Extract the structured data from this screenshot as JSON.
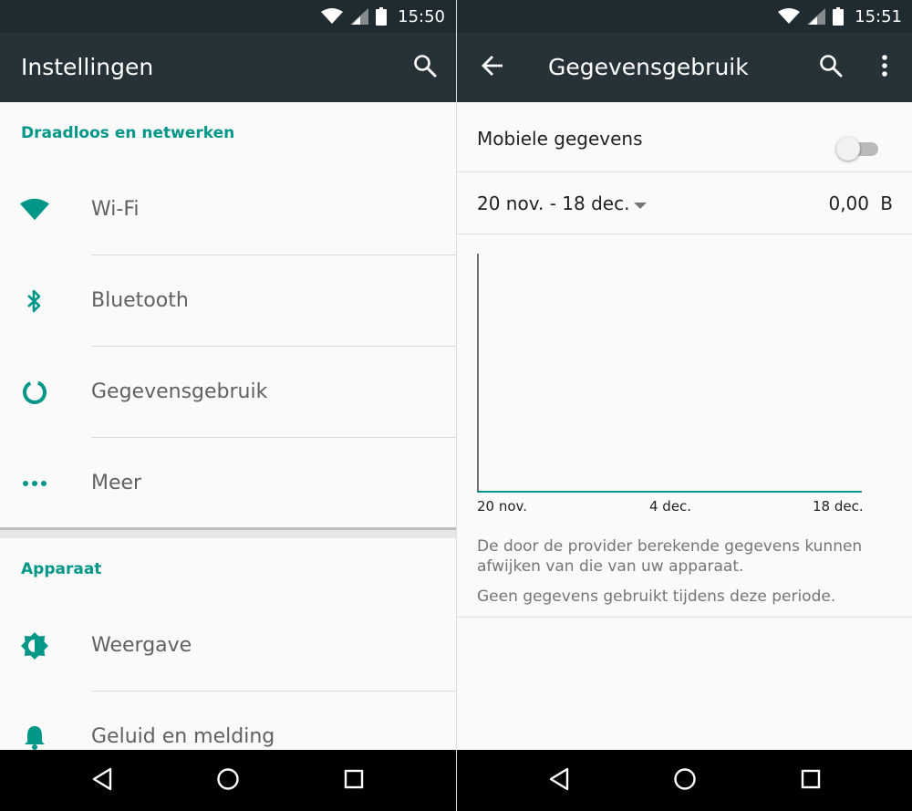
{
  "left": {
    "status": {
      "time": "15:50"
    },
    "appbar": {
      "title": "Instellingen",
      "search_icon": "search-icon"
    },
    "sections": [
      {
        "header": "Draadloos en netwerken",
        "items": [
          {
            "label": "Wi-Fi",
            "icon": "wifi-icon"
          },
          {
            "label": "Bluetooth",
            "icon": "bluetooth-icon"
          },
          {
            "label": "Gegevensgebruik",
            "icon": "data-usage-icon"
          },
          {
            "label": "Meer",
            "icon": "more-dots-icon"
          }
        ]
      },
      {
        "header": "Apparaat",
        "items": [
          {
            "label": "Weergave",
            "icon": "brightness-icon"
          },
          {
            "label": "Geluid en melding",
            "icon": "bell-icon"
          }
        ]
      }
    ]
  },
  "right": {
    "status": {
      "time": "15:51"
    },
    "appbar": {
      "title": "Gegevensgebruik",
      "back_icon": "back-arrow-icon",
      "search_icon": "search-icon",
      "overflow_icon": "overflow-menu-icon"
    },
    "mobile_data": {
      "label": "Mobiele gegevens",
      "enabled": false
    },
    "cycle": {
      "range": "20 nov. - 18 dec.",
      "amount": "0,00",
      "unit": "B"
    },
    "chart_data": {
      "type": "line",
      "x": [
        "20 nov.",
        "4 dec.",
        "18 dec."
      ],
      "series": [
        {
          "values": [
            0,
            0,
            0
          ]
        }
      ],
      "xlabel": "",
      "ylabel": ""
    },
    "notes": {
      "provider": "De door de provider berekende gegevens kunnen afwijken van die van uw apparaat.",
      "none_used": "Geen gegevens gebruikt tijdens deze periode."
    }
  },
  "colors": {
    "accent": "#009688",
    "appbar": "#263238",
    "statusbar": "#1f2b30"
  },
  "navbar": {
    "icons": [
      "back-triangle-icon",
      "home-circle-icon",
      "recents-square-icon"
    ]
  }
}
